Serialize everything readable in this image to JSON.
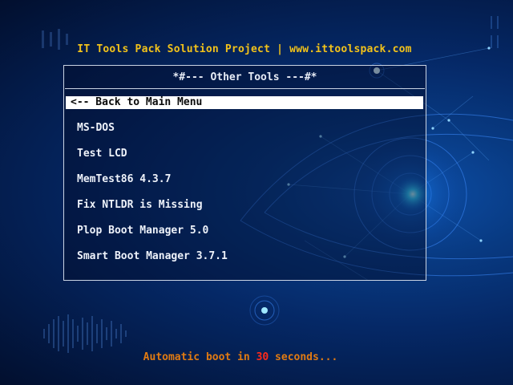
{
  "header": {
    "title": "IT Tools Pack Solution Project | www.ittoolspack.com"
  },
  "menu": {
    "title": "*#--- Other Tools ---#*",
    "selected_index": 0,
    "items": [
      {
        "label": "<-- Back to Main Menu"
      },
      {
        "label": "MS-DOS"
      },
      {
        "label": "Test LCD"
      },
      {
        "label": "MemTest86 4.3.7"
      },
      {
        "label": "Fix NTLDR is Missing"
      },
      {
        "label": "Plop Boot Manager 5.0"
      },
      {
        "label": "Smart Boot Manager 3.7.1"
      }
    ]
  },
  "footer": {
    "prefix": "Automatic boot in",
    "seconds": "30",
    "suffix": "seconds..."
  },
  "colors": {
    "header": "#f2c21a",
    "footer": "#e07a12",
    "countdown": "#ff2a1a",
    "selection_bg": "#ffffff",
    "background": "#052866"
  }
}
